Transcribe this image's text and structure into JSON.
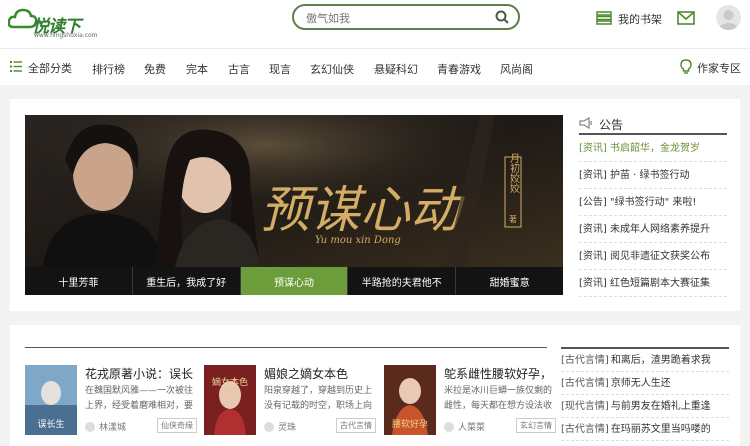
{
  "header": {
    "logo_text": "悦读下",
    "logo_url": "www.hingshuxia.com",
    "search_placeholder": "傲气如我",
    "bookshelf_label": "我的书架"
  },
  "nav": {
    "all_label": "全部分类",
    "items": [
      "排行榜",
      "免费",
      "完本",
      "古言",
      "现言",
      "玄幻仙侠",
      "悬疑科幻",
      "青春游戏",
      "风尚阁"
    ],
    "author_label": "作家专区"
  },
  "banner": {
    "title_cn": "预谋心动",
    "title_pinyin": "Yu mou xin Dong",
    "author_seal": "月初姣姣",
    "author_suffix": "著",
    "tabs": [
      "十里芳菲",
      "重生后，我成了好",
      "预谋心动",
      "半路抢的夫君他不",
      "甜婚蜜意"
    ],
    "active_tab": 2
  },
  "notice": {
    "title": "公告",
    "items": [
      "[资讯] 书启韶华，金龙贺岁",
      "[资讯] 护苗 · 绿书签行动",
      "[公告] \"绿书签行动\" 来啦!",
      "[资讯] 未成年人网络素养提升",
      "[资讯] 阅见非遗征文获奖公布",
      "[资讯] 红色短篇剧本大赛征集"
    ]
  },
  "books": [
    {
      "title": "花戎原著小说：误长",
      "desc": "在魏国默风雅——一次被往上界，经受着磨难相对，要确",
      "author": "林漾城",
      "tag": "仙侠奇缘",
      "cover_text": "误长生"
    },
    {
      "title": "媚娘之嫡女本色",
      "desc": "阳泉穿越了，穿越到历史上没有记载的时空，职场上向",
      "author": "灵珠",
      "tag": "古代言情",
      "cover_text": "嫡女本色"
    },
    {
      "title": "鸵系雌性腰软好孕，",
      "desc": "米拉是冰川巨蟒一族仅剩的雌性，每天都在想方设法收",
      "author": "人菜菜",
      "tag": "玄幻言情",
      "cover_text": "腰软好孕"
    }
  ],
  "side_list": [
    {
      "cat": "[古代言情]",
      "text": "和离后，渣男跪着求我"
    },
    {
      "cat": "[古代言情]",
      "text": "京师无人生还"
    },
    {
      "cat": "[现代言情]",
      "text": "与前男友在婚礼上重逢"
    },
    {
      "cat": "[古代言情]",
      "text": "在玛丽苏文里当吗喽的"
    }
  ],
  "colors": {
    "brand_green": "#2f7d2f",
    "accent_green": "#6d9c3b",
    "search_border": "#5f7f4b"
  }
}
